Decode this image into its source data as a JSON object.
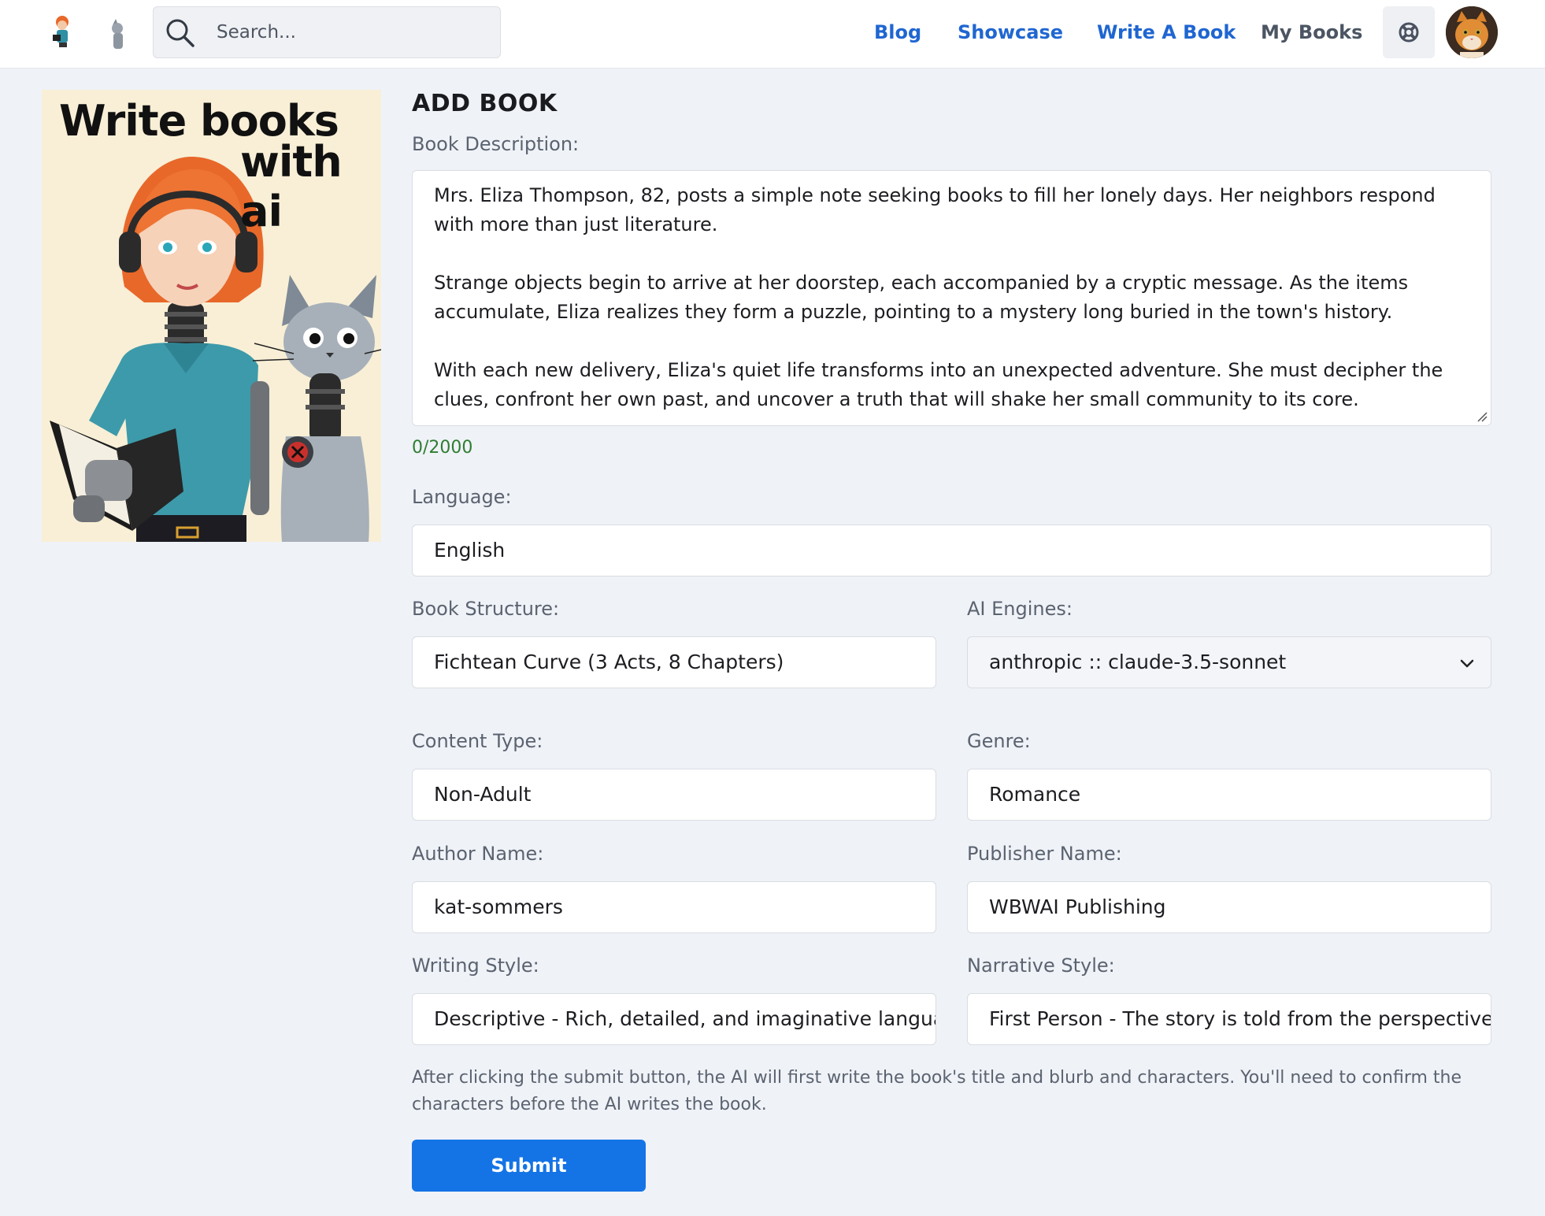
{
  "header": {
    "search_placeholder": "Search...",
    "nav": {
      "blog": "Blog",
      "showcase": "Showcase",
      "write_a_book": "Write A Book",
      "my_books": "My Books"
    }
  },
  "cover": {
    "line1": "Write books",
    "line2": "with ai"
  },
  "form": {
    "heading": "ADD BOOK",
    "description": {
      "label": "Book Description:",
      "paragraphs": [
        "Mrs. Eliza Thompson, 82, posts a simple note seeking books to fill her lonely days. Her neighbors respond with more than just literature.",
        "Strange objects begin to arrive at her doorstep, each accompanied by a cryptic message. As the items accumulate, Eliza realizes they form a puzzle, pointing to a mystery long buried in the town's history.",
        "With each new delivery, Eliza's quiet life transforms into an unexpected adventure. She must decipher the clues, confront her own past, and uncover a truth that will shake her small community to its core."
      ],
      "counter": "0/2000"
    },
    "language": {
      "label": "Language:",
      "value": "English"
    },
    "book_structure": {
      "label": "Book Structure:",
      "value": "Fichtean Curve (3 Acts, 8 Chapters)"
    },
    "ai_engines": {
      "label": "AI Engines:",
      "value": "anthropic :: claude-3.5-sonnet"
    },
    "content_type": {
      "label": "Content Type:",
      "value": "Non-Adult"
    },
    "genre": {
      "label": "Genre:",
      "value": "Romance"
    },
    "author_name": {
      "label": "Author Name:",
      "value": "kat-sommers"
    },
    "publisher_name": {
      "label": "Publisher Name:",
      "value": "WBWAI Publishing"
    },
    "writing_style": {
      "label": "Writing Style:",
      "value": "Descriptive - Rich, detailed, and imaginative language"
    },
    "narrative_style": {
      "label": "Narrative Style:",
      "value": "First Person - The story is told from the perspective of a character"
    },
    "note": "After clicking the submit button, the AI will first write the book's title and blurb and characters. You'll need to confirm the characters before the AI writes the book.",
    "submit_label": "Submit"
  },
  "colors": {
    "accent": "#1f66d1",
    "submit": "#1474e6",
    "counter": "#2f7d32",
    "background": "#eff2f7"
  },
  "icons": {
    "search": "search-icon",
    "help": "lifebuoy-icon",
    "dropdown": "chevron-down-icon"
  }
}
